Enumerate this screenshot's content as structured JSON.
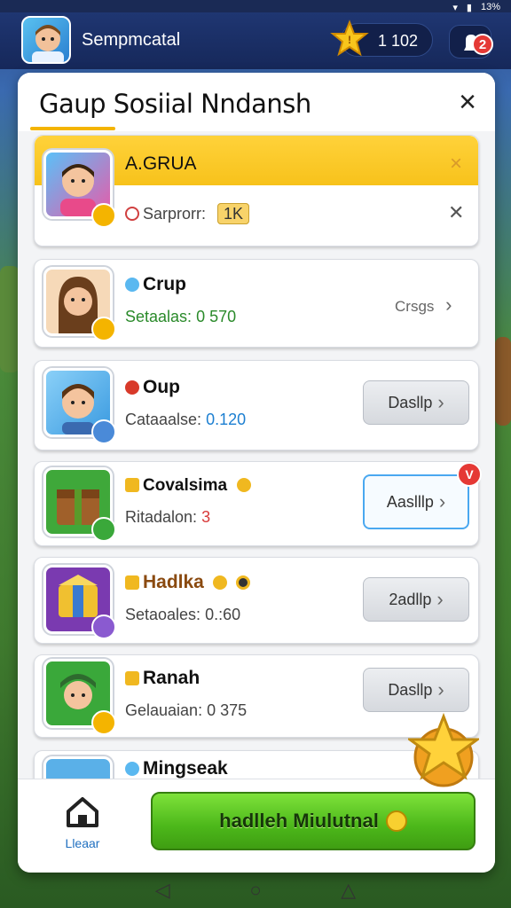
{
  "status_bar": {
    "battery": "13%"
  },
  "top_bar": {
    "player_name": "Sempmcatal",
    "coins": "1 102",
    "notifications": "2"
  },
  "dialog": {
    "title": "Gaup Sosiial Nndansh",
    "close_icon": "close-icon",
    "cards": [
      {
        "name": "A.GRUA",
        "sub_label": "Sarprorr:",
        "sub_value": "1K",
        "variant": "featured"
      },
      {
        "name": "Crup",
        "sub_label": "Setaalas:",
        "sub_value": "0 570",
        "side_label": "Crsgs",
        "variant": "plain"
      },
      {
        "name": "Oup",
        "sub_label": "Cataaalse:",
        "sub_value": "0.120",
        "action": "Dasllp",
        "variant": "button"
      },
      {
        "name": "Covalsima",
        "sub_label": "Ritadalon:",
        "sub_value": "3",
        "action": "Aaslllp",
        "badge": "V",
        "variant": "active"
      },
      {
        "name": "Hadlka",
        "sub_label": "Setaoales:",
        "sub_value": "0.:60",
        "action": "2adllp",
        "variant": "button"
      },
      {
        "name": "Ranah",
        "sub_label": "Gelauaian:",
        "sub_value": "0 375",
        "action": "Dasllp",
        "variant": "button"
      },
      {
        "name": "Mingseak",
        "variant": "partial"
      }
    ]
  },
  "bottom_bar": {
    "home_label": "Lleaar",
    "cta_label": "hadlleh Miulutnal"
  },
  "colors": {
    "accent": "#f4b400",
    "cta": "#4cb71a",
    "link": "#1c7fd1",
    "badge": "#e53935"
  }
}
